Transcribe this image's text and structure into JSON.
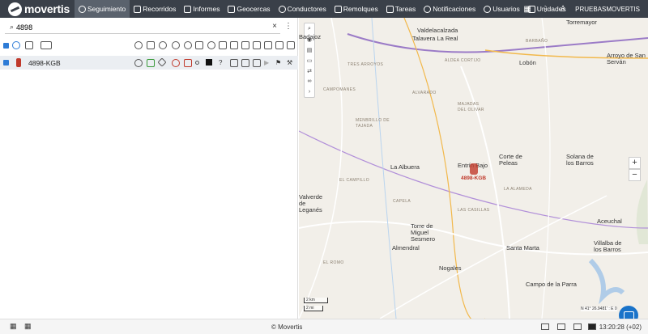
{
  "brand": "movertis",
  "nav": [
    {
      "label": "Seguimiento",
      "icon": "globe-icon",
      "active": true
    },
    {
      "label": "Recorridos",
      "icon": "flag-icon"
    },
    {
      "label": "Informes",
      "icon": "chart-icon"
    },
    {
      "label": "Geocercas",
      "icon": "pentagon-icon"
    },
    {
      "label": "Conductores",
      "icon": "steering-wheel-icon"
    },
    {
      "label": "Remolques",
      "icon": "trailer-icon"
    },
    {
      "label": "Tareas",
      "icon": "checklist-icon"
    },
    {
      "label": "Notificaciones",
      "icon": "alarm-icon"
    },
    {
      "label": "Usuarios",
      "icon": "users-icon"
    },
    {
      "label": "Unidades",
      "icon": "bus-icon"
    }
  ],
  "user": "PRUEBASMOVERTIS",
  "search": {
    "value": "4898",
    "placeholder": ""
  },
  "vehicle": {
    "plate": "4898-KGB",
    "color": "#c0392b"
  },
  "map": {
    "labels": [
      {
        "text": "Badajoz",
        "cls": "big"
      },
      {
        "text": "Valdelacalzada",
        "cls": "big"
      },
      {
        "text": "Torremayor",
        "cls": "big"
      },
      {
        "text": "Talavera La Real",
        "cls": "big"
      },
      {
        "text": "BARBAÑO",
        "cls": "small"
      },
      {
        "text": "Arroyo de San Serván",
        "cls": "big"
      },
      {
        "text": "TRES ARROYOS",
        "cls": "small"
      },
      {
        "text": "ALDEA CORTIJO",
        "cls": "small"
      },
      {
        "text": "Lobón",
        "cls": "big"
      },
      {
        "text": "CAMPOMANES",
        "cls": "small"
      },
      {
        "text": "ALVARADO",
        "cls": "small"
      },
      {
        "text": "MAJADAS DEL OLIVAR",
        "cls": "small"
      },
      {
        "text": "MENBRILLO DE TAJADA",
        "cls": "small"
      },
      {
        "text": "Entrín Bajo",
        "cls": "big"
      },
      {
        "text": "Corte de Peleas",
        "cls": "big"
      },
      {
        "text": "Solana de los Barros",
        "cls": "big"
      },
      {
        "text": "La Albuera",
        "cls": "big"
      },
      {
        "text": "EL CAMPILLO",
        "cls": "small"
      },
      {
        "text": "LA ALAMEDA",
        "cls": "small"
      },
      {
        "text": "Valverde de Leganés",
        "cls": "big"
      },
      {
        "text": "CAPELA",
        "cls": "small"
      },
      {
        "text": "LAS CASILLAS",
        "cls": "small"
      },
      {
        "text": "Aceuchal",
        "cls": "big"
      },
      {
        "text": "Torre de Miguel Sesmero",
        "cls": "big"
      },
      {
        "text": "Almendral",
        "cls": "big"
      },
      {
        "text": "Santa Marta",
        "cls": "big"
      },
      {
        "text": "Villalba de los Barros",
        "cls": "big"
      },
      {
        "text": "Nogales",
        "cls": "big"
      },
      {
        "text": "EL ROMO",
        "cls": "small"
      },
      {
        "text": "Campo de la Parra",
        "cls": "big"
      }
    ],
    "scale_km": "2 km",
    "scale_mi": "2 mi",
    "coords": "N 41° 26.9481' : E 0"
  },
  "footer": {
    "copyright": "© Movertis",
    "time": "13:20:28 (+02)"
  }
}
